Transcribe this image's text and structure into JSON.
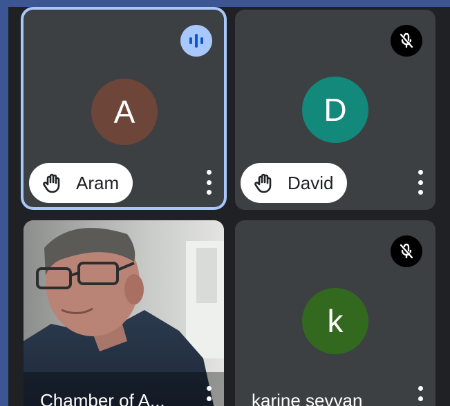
{
  "participants": [
    {
      "initial": "A",
      "name": "Aram",
      "avatar_color": "#6d4639",
      "hand_raised": true,
      "status": "speaking",
      "status_icon": "audio-levels-icon"
    },
    {
      "initial": "D",
      "name": "David",
      "avatar_color": "#12897a",
      "hand_raised": true,
      "status": "muted",
      "status_icon": "mic-off-icon"
    },
    {
      "name": "Chamber of A...",
      "video": true
    },
    {
      "initial": "k",
      "name": "karine sevyan",
      "avatar_color": "#33691e",
      "status": "muted",
      "status_icon": "mic-off-icon"
    }
  ],
  "colors": {
    "background": "#202124",
    "tile": "#3c4043",
    "speaking_outline": "#a8c7fa",
    "frame": "#3c5694"
  }
}
